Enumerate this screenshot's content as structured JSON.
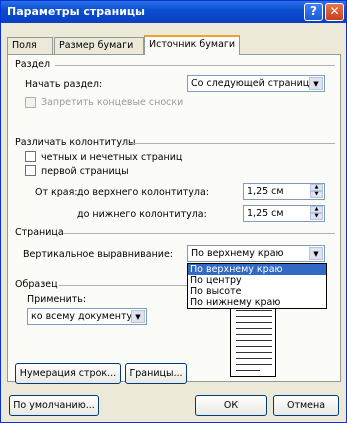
{
  "window": {
    "title": "Параметры страницы",
    "help_glyph": "?",
    "close_glyph": "✕"
  },
  "tabs": [
    {
      "label": "Поля"
    },
    {
      "label": "Размер бумаги"
    },
    {
      "label": "Источник бумаги"
    }
  ],
  "section_razdel": {
    "title": "Раздел",
    "start_label": "Начать раздел:",
    "start_value": "Со следующей страницы",
    "endnotes_label": "Запретить концевые сноски"
  },
  "section_headers": {
    "title": "Различать колонтитулы",
    "odd_even_label": "четных и нечетных страниц",
    "first_page_label": "первой страницы",
    "from_edge_label": "От края:",
    "header_label": "до верхнего колонтитула:",
    "header_value": "1,25 см",
    "footer_label": "до нижнего колонтитула:",
    "footer_value": "1,25 см"
  },
  "section_page": {
    "title": "Страница",
    "valign_label": "Вертикальное выравнивание:",
    "valign_value": "По верхнему краю",
    "valign_options": [
      "По верхнему краю",
      "По центру",
      "По высоте",
      "По нижнему краю"
    ]
  },
  "section_sample": {
    "title": "Образец",
    "apply_label": "Применить:",
    "apply_value": "ко всему документу"
  },
  "buttons": {
    "line_numbers": "Нумерация строк...",
    "borders": "Границы...",
    "default": "По умолчанию...",
    "ok": "ОК",
    "cancel": "Отмена"
  },
  "icons": {
    "combo_arrow": "▼",
    "spin_up": "▲",
    "spin_down": "▼"
  }
}
